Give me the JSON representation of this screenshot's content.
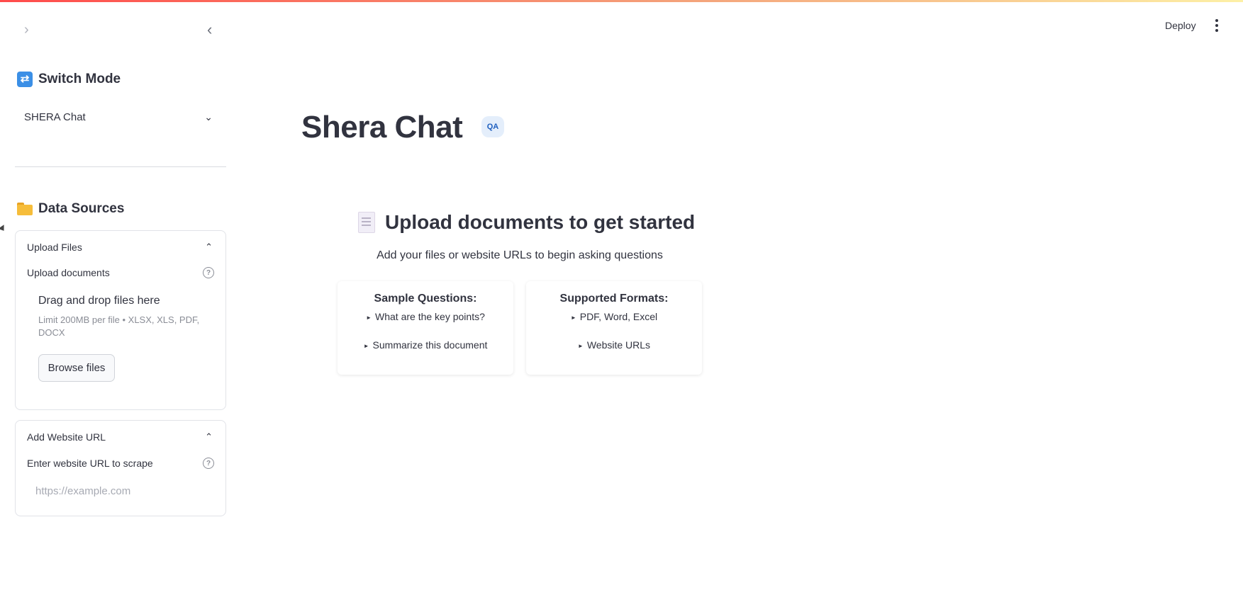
{
  "header": {
    "deploy_label": "Deploy"
  },
  "sidebar": {
    "mode_section": {
      "title": "Switch Mode",
      "icon": "shuffle-icon",
      "selected_mode": "SHERA Chat"
    },
    "data_sources": {
      "title": "Data Sources",
      "icon": "folder-icon",
      "upload_expander": {
        "title": "Upload Files",
        "field_label": "Upload documents",
        "dropzone_title": "Drag and drop files here",
        "dropzone_limit": "Limit 200MB per file • XLSX, XLS, PDF, DOCX",
        "browse_label": "Browse files"
      },
      "url_expander": {
        "title": "Add Website URL",
        "field_label": "Enter website URL to scrape",
        "placeholder": "https://example.com"
      }
    }
  },
  "main": {
    "title": "Shera Chat",
    "badge": "QA",
    "upload_heading": "Upload documents to get started",
    "upload_subtitle": "Add your files or website URLs to begin asking questions",
    "cards": [
      {
        "title": "Sample Questions:",
        "items": [
          "What are the key points?",
          "Summarize this document"
        ]
      },
      {
        "title": "Supported Formats:",
        "items": [
          "PDF, Word, Excel",
          "Website URLs"
        ]
      }
    ]
  },
  "colors": {
    "text": "#31333f",
    "accent_gradient_start": "#ff4b4b",
    "badge_bg": "#e4eefb",
    "badge_text": "#1f5fbf"
  }
}
